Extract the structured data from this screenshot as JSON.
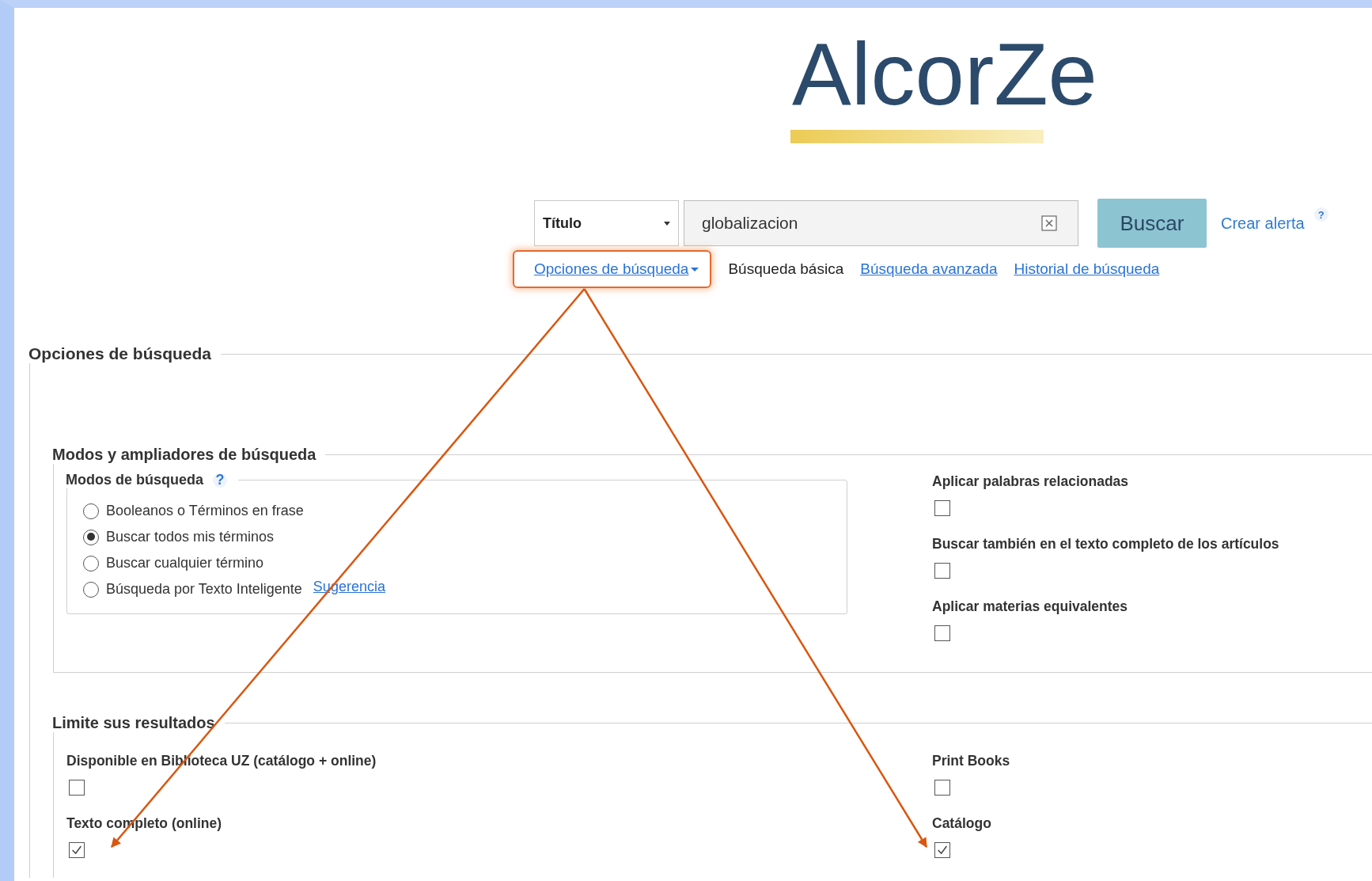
{
  "logo": {
    "text": "AlcorZe"
  },
  "search": {
    "field": "Título",
    "query": "globalizacion",
    "submit": "Buscar",
    "alert_link": "Crear alerta",
    "help": "?"
  },
  "search_links": [
    {
      "label": "Opciones de búsqueda",
      "kind": "dropdown",
      "highlighted": true
    },
    {
      "label": "Búsqueda básica",
      "kind": "current",
      "highlighted": false
    },
    {
      "label": "Búsqueda avanzada",
      "kind": "link",
      "highlighted": false
    },
    {
      "label": "Historial de búsqueda",
      "kind": "link",
      "highlighted": false
    }
  ],
  "options": {
    "title": "Opciones de búsqueda",
    "modes_expanders": {
      "title": "Modos y ampliadores de búsqueda",
      "modes": {
        "title": "Modos de búsqueda",
        "help": "?",
        "items": [
          {
            "label": "Booleanos o Términos en frase",
            "selected": false
          },
          {
            "label": "Buscar todos mis términos",
            "selected": true
          },
          {
            "label": "Buscar cualquier término",
            "selected": false
          },
          {
            "label": "Búsqueda por Texto Inteligente",
            "selected": false,
            "tip_link": "Sugerencia"
          }
        ]
      },
      "expanders": [
        {
          "label": "Aplicar palabras relacionadas",
          "checked": false
        },
        {
          "label": "Buscar también en el texto completo de los artículos",
          "checked": false
        },
        {
          "label": "Aplicar materias equivalentes",
          "checked": false
        }
      ]
    },
    "limits": {
      "title": "Limite sus resultados",
      "items": [
        {
          "label": "Disponible en Biblioteca UZ (catálogo + online)",
          "checked": false,
          "arrow": false
        },
        {
          "label": "Print Books",
          "checked": false,
          "arrow": false
        },
        {
          "label": "Texto completo (online)",
          "checked": true,
          "arrow": true
        },
        {
          "label": "Catálogo",
          "checked": true,
          "arrow": true
        }
      ]
    }
  }
}
